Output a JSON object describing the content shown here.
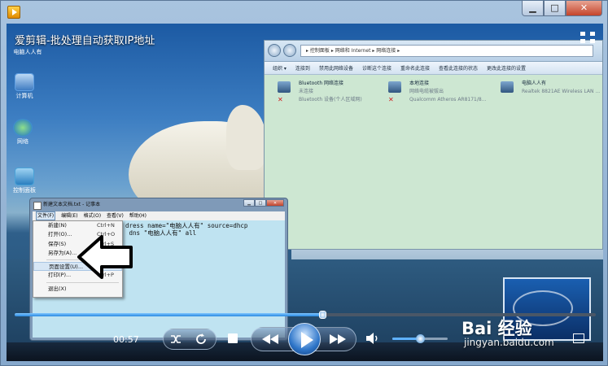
{
  "window": {
    "minimize": "▁",
    "maximize": "□",
    "close": "✕"
  },
  "video": {
    "title": "爱剪辑-批处理自动获取IP地址"
  },
  "desktop_icons": [
    {
      "label": "电脑人人有",
      "color": "#5d8bbf"
    },
    {
      "label": "计算机",
      "color": "#5f9fe3"
    },
    {
      "label": "网络",
      "color": "#3f8fd0"
    },
    {
      "label": "控制面板",
      "color": "#4aa3d8"
    }
  ],
  "explorer": {
    "address": "▸ 控制面板 ▸ 网络和 Internet ▸ 网络连接 ▸",
    "commands": [
      "组织 ▾",
      "连接到",
      "禁用此网络设备",
      "诊断这个连接",
      "重命名此连接",
      "查看此连接的状态",
      "更改此连接的设置"
    ],
    "connections": [
      {
        "name": "Bluetooth 网络连接",
        "status": "未连接",
        "device": "Bluetooth 设备(个人区域网)",
        "x": "✕"
      },
      {
        "name": "本地连接",
        "status": "网络电缆被拔出",
        "device": "Qualcomm Atheros AR8171/8...",
        "x": "✕"
      },
      {
        "name": "电脑人人有",
        "status": "",
        "device": "Realtek 8821AE Wireless LAN ..."
      }
    ]
  },
  "notepad": {
    "title": "新建文本文档.txt - 记事本",
    "menus": [
      "文件(F)",
      "编辑(E)",
      "格式(O)",
      "查看(V)",
      "帮助(H)"
    ],
    "lines": [
      "dress name=\"电脑人人有\" source=dhcp",
      " dns \"电脑人人有\" all"
    ],
    "file_menu": [
      {
        "label": "新建(N)",
        "shortcut": "Ctrl+N"
      },
      {
        "label": "打开(O)...",
        "shortcut": "Ctrl+O"
      },
      {
        "label": "保存(S)",
        "shortcut": "Ctrl+S"
      },
      {
        "label": "另存为(A)...",
        "shortcut": ""
      },
      {
        "label": "页面设置(U)...",
        "shortcut": ""
      },
      {
        "label": "打印(P)...",
        "shortcut": "Ctrl+P"
      },
      {
        "label": "退出(X)",
        "shortcut": ""
      }
    ]
  },
  "player": {
    "time": "00:57",
    "progress": 0.53,
    "volume": 0.5,
    "accent": "#2b89e0"
  },
  "watermark": {
    "brand": "Bai 经验",
    "url": "jingyan.baidu.com"
  }
}
